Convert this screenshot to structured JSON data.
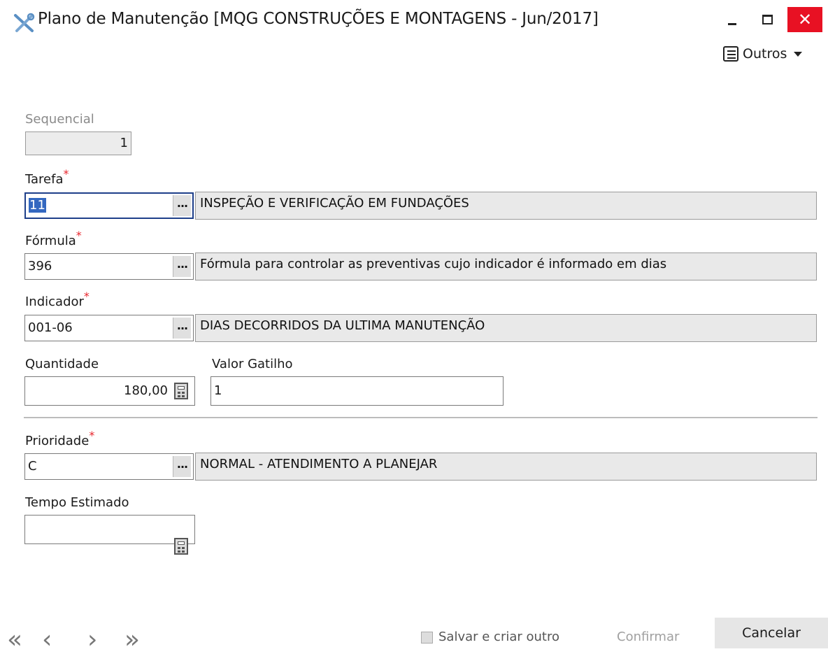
{
  "window": {
    "title": "Plano de Manutenção [MQG CONSTRUÇÕES E MONTAGENS - Jun/2017]",
    "minimize_icon": "minimize-icon",
    "maximize_icon": "maximize-icon",
    "close_glyph": "✕"
  },
  "toolbar": {
    "outros_label": "Outros"
  },
  "form": {
    "sequencial": {
      "label": "Sequencial",
      "value": "1"
    },
    "tarefa": {
      "label": "Tarefa",
      "required": "*",
      "code": "11",
      "description": "INSPEÇÃO E VERIFICAÇÃO EM FUNDAÇÕES"
    },
    "formula": {
      "label": "Fórmula",
      "required": "*",
      "code": "396",
      "description": "Fórmula para controlar as preventivas cujo indicador é informado em dias"
    },
    "indicador": {
      "label": "Indicador",
      "required": "*",
      "code": "001-06",
      "description": "DIAS DECORRIDOS DA ULTIMA MANUTENÇÃO"
    },
    "quantidade": {
      "label": "Quantidade",
      "value": "180,00"
    },
    "valor_gatilho": {
      "label": "Valor Gatilho",
      "value": "1"
    },
    "prioridade": {
      "label": "Prioridade",
      "required": "*",
      "code": "C",
      "description": "NORMAL - ATENDIMENTO A PLANEJAR"
    },
    "tempo_estimado": {
      "label": "Tempo Estimado",
      "value": ""
    },
    "ellipsis": "···"
  },
  "footer": {
    "nav_first": "«",
    "nav_prev": "‹",
    "nav_next": "›",
    "nav_last": "»",
    "save_and_new_label": "Salvar e criar outro",
    "confirm_label": "Confirmar",
    "cancel_label": "Cancelar"
  },
  "colors": {
    "required": "#e8262d",
    "close_button": "#e81123",
    "selection": "#3468c0"
  }
}
